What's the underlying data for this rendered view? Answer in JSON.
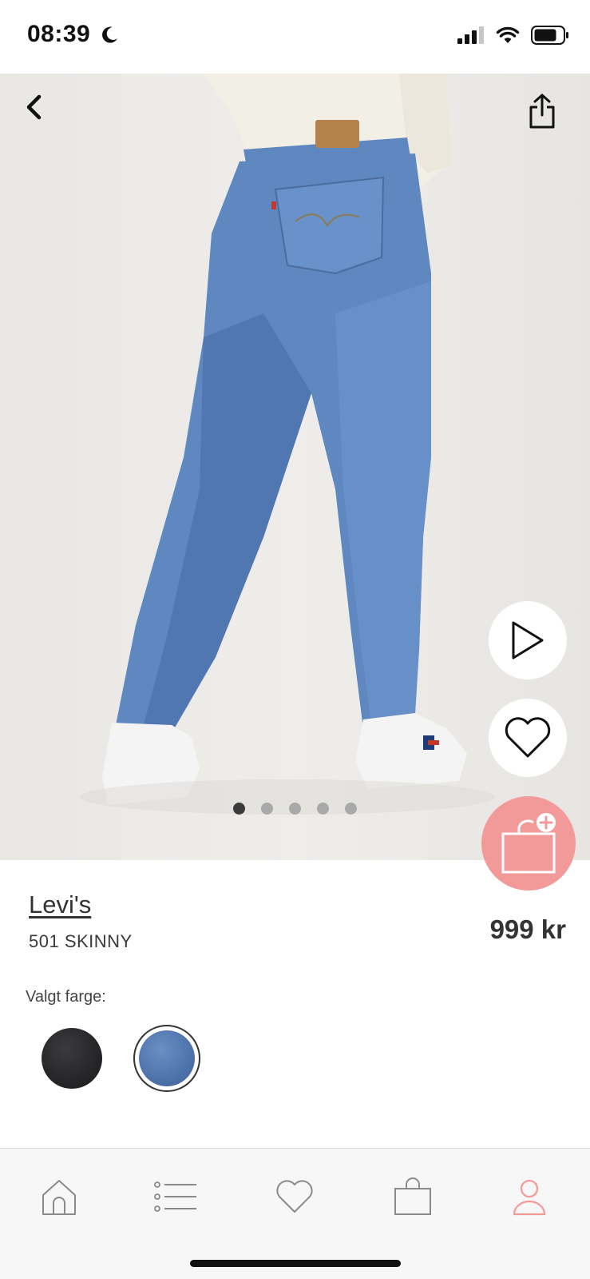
{
  "status_bar": {
    "time": "08:39",
    "icons": [
      "moon-icon",
      "cellular-signal-icon",
      "wifi-icon",
      "battery-icon"
    ]
  },
  "hero": {
    "image_description": "",
    "carousel": {
      "count": 5,
      "active_index": 0
    },
    "actions": [
      "back-icon",
      "share-icon",
      "play-icon",
      "heart-icon",
      "add-to-bag-icon"
    ]
  },
  "product": {
    "brand": "Levi's",
    "name": "501 SKINNY",
    "price": "999 kr",
    "color_label": "Valgt farge:",
    "colors": [
      {
        "name": "black",
        "selected": false,
        "hex": "#262628"
      },
      {
        "name": "blue",
        "selected": true,
        "hex": "#4e73ab"
      }
    ]
  },
  "tabbar": {
    "items": [
      {
        "icon": "home-icon",
        "active": false
      },
      {
        "icon": "list-icon",
        "active": false
      },
      {
        "icon": "heart-icon",
        "active": false
      },
      {
        "icon": "bag-icon",
        "active": false
      },
      {
        "icon": "profile-icon",
        "active": true
      }
    ]
  },
  "colors": {
    "accent": "#f29a99",
    "inactive_icon": "#8a8a8a",
    "text": "#333333"
  }
}
